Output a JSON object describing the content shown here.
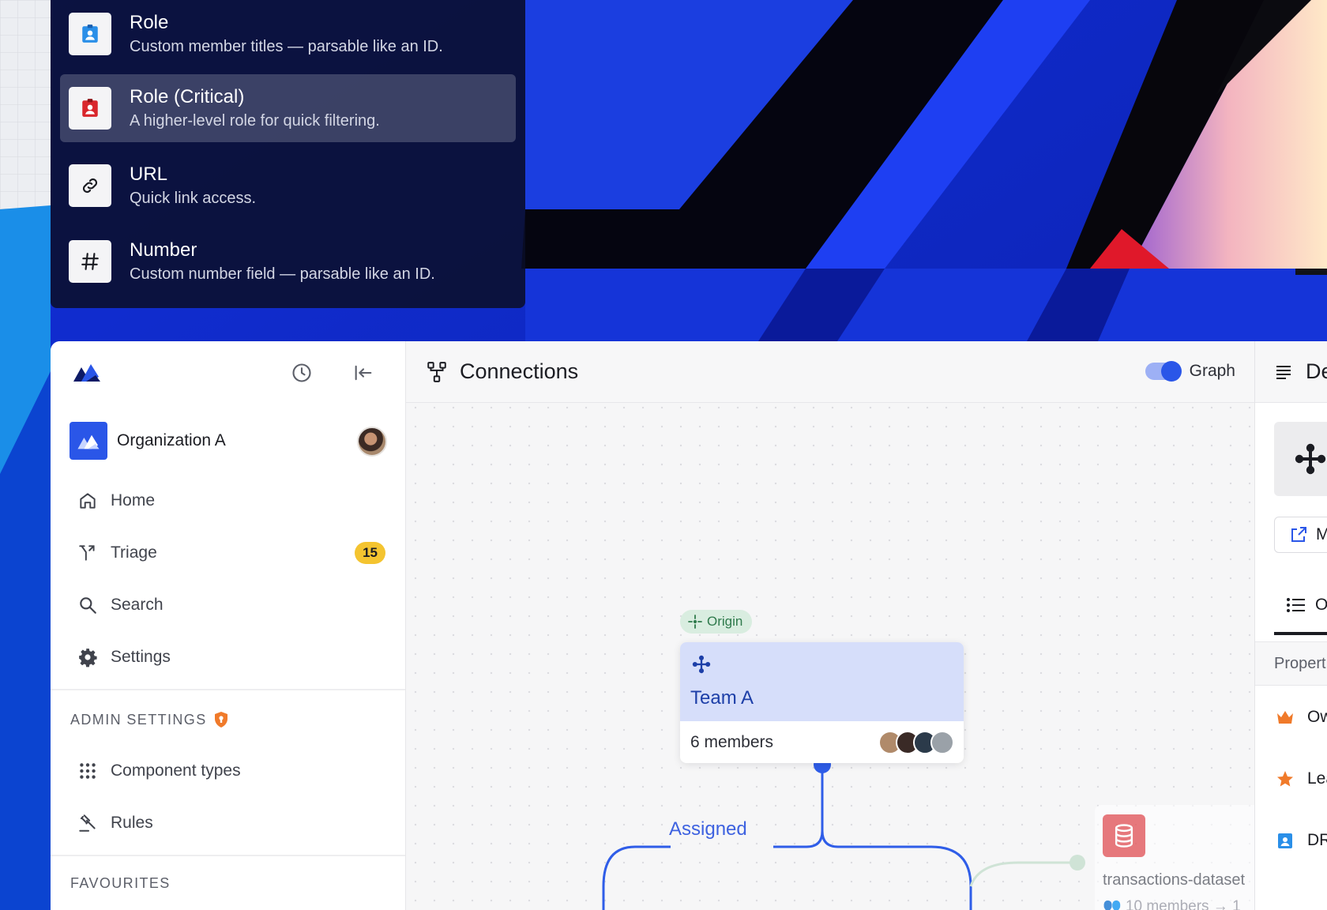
{
  "menu": {
    "items": [
      {
        "title": "Role",
        "subtitle": "Custom member titles — parsable like an ID.",
        "icon": "role-badge-icon"
      },
      {
        "title": "Role (Critical)",
        "subtitle": "A higher-level role for quick filtering.",
        "icon": "critical-role-badge-icon"
      },
      {
        "title": "URL",
        "subtitle": "Quick link access.",
        "icon": "link-icon"
      },
      {
        "title": "Number",
        "subtitle": "Custom number field — parsable like an ID.",
        "icon": "hash-icon"
      }
    ]
  },
  "sidebar": {
    "org_name": "Organization A",
    "nav": [
      {
        "label": "Home",
        "icon": "home-icon"
      },
      {
        "label": "Triage",
        "icon": "triage-icon",
        "badge": "15"
      },
      {
        "label": "Search",
        "icon": "search-icon"
      },
      {
        "label": "Settings",
        "icon": "gear-icon"
      }
    ],
    "admin_label": "ADMIN SETTINGS",
    "admin_items": [
      {
        "label": "Component types",
        "icon": "grid-dots-icon"
      },
      {
        "label": "Rules",
        "icon": "gavel-icon"
      }
    ],
    "favourites_label": "FAVOURITES"
  },
  "main": {
    "title": "Connections",
    "toggle_label": "Graph",
    "toggle_on": true,
    "origin_label": "Origin",
    "node": {
      "title": "Team A",
      "members": "6 members"
    },
    "edge_label": "Assigned",
    "dataset": {
      "name": "transactions-dataset",
      "members": "10 members → 1"
    }
  },
  "detail": {
    "title": "De",
    "button": "M",
    "tab": "O",
    "props_label": "Propert",
    "rows": [
      {
        "label": "Ow",
        "icon": "crown-icon"
      },
      {
        "label": "Lea",
        "icon": "star-icon"
      },
      {
        "label": "DR",
        "icon": "role-badge-icon"
      }
    ]
  },
  "colors": {
    "accent": "#2a56e8",
    "badge": "#f4c430",
    "origin": "#2f7a4c",
    "critical": "#d9262c"
  }
}
